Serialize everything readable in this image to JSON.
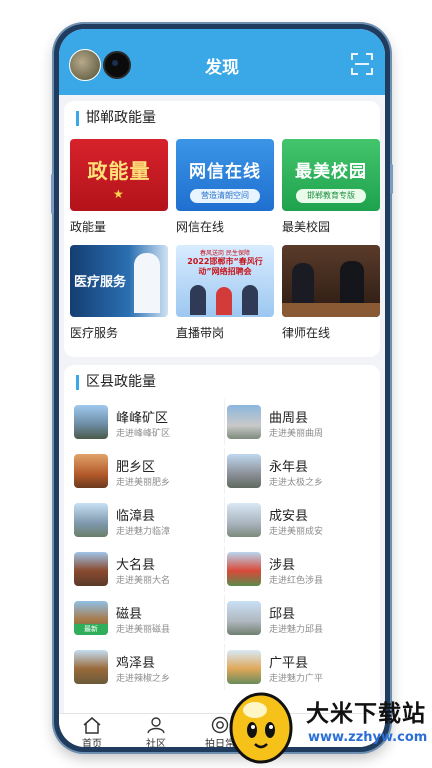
{
  "header": {
    "title": "发现"
  },
  "section1": {
    "title": "邯郸政能量",
    "tiles": [
      {
        "label": "政能量",
        "img_text": "政能量",
        "img_sub": ""
      },
      {
        "label": "网信在线",
        "img_text": "网信在线",
        "img_sub": "营造清朗空间"
      },
      {
        "label": "最美校园",
        "img_text": "最美校园",
        "img_sub": "邯郸教育专版"
      },
      {
        "label": "医疗服务",
        "img_text": "医疗服务",
        "img_sub": ""
      },
      {
        "label": "直播带岗",
        "img_text": "2022邯郸市“春风行动”网络招聘会",
        "img_sub": "春风送岗 民生保障"
      },
      {
        "label": "律师在线",
        "img_text": "",
        "img_sub": ""
      }
    ]
  },
  "section2": {
    "title": "区县政能量",
    "counties": [
      {
        "name": "峰峰矿区",
        "sub": "走进峰峰矿区"
      },
      {
        "name": "曲周县",
        "sub": "走进美丽曲周"
      },
      {
        "name": "肥乡区",
        "sub": "走进美丽肥乡"
      },
      {
        "name": "永年县",
        "sub": "走进太极之乡"
      },
      {
        "name": "临漳县",
        "sub": "走进魅力临漳"
      },
      {
        "name": "成安县",
        "sub": "走进美丽成安"
      },
      {
        "name": "大名县",
        "sub": "走进美丽大名"
      },
      {
        "name": "涉县",
        "sub": "走进红色涉县"
      },
      {
        "name": "磁县",
        "sub": "走进美丽磁县",
        "badge": "最新"
      },
      {
        "name": "邱县",
        "sub": "走进魅力邱县"
      },
      {
        "name": "鸡泽县",
        "sub": "走进辣椒之乡"
      },
      {
        "name": "广平县",
        "sub": "走进魅力广平"
      }
    ]
  },
  "nav": [
    {
      "label": "首页",
      "icon": "home-icon"
    },
    {
      "label": "社区",
      "icon": "community-icon"
    },
    {
      "label": "拍日常",
      "icon": "camera-icon"
    }
  ],
  "watermark": {
    "title": "大米下载站",
    "url": "www.zzhyw.com"
  }
}
